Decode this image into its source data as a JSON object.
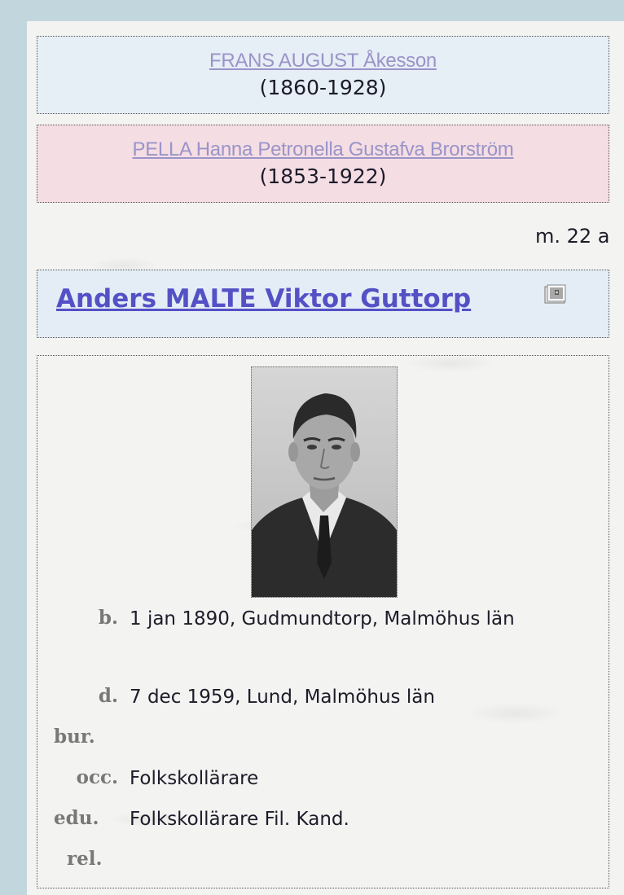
{
  "father": {
    "name": "FRANS AUGUST Åkesson",
    "years": "(1860-1928)"
  },
  "mother": {
    "name": "PELLA Hanna Petronella Gustafva Brorström",
    "years": "(1853-1922)"
  },
  "marriage": {
    "text": "m. 22 a"
  },
  "person": {
    "name": "Anders MALTE Viktor Guttorp",
    "album_icon": "photo-album-icon"
  },
  "facts": {
    "birth": {
      "label": "b.",
      "value": "1 jan 1890, Gudmundtorp, Malmöhus län"
    },
    "death": {
      "label": "d.",
      "value": "7 dec 1959, Lund, Malmöhus län"
    },
    "burial": {
      "label": "bur.",
      "value": ""
    },
    "occupation": {
      "label": "occ.",
      "value": "Folkskollärare"
    },
    "education": {
      "label": "edu.",
      "value": "Folkskollärare Fil. Kand."
    },
    "religion": {
      "label": "rel.",
      "value": ""
    }
  },
  "colors": {
    "father_box": "#e6eef6",
    "mother_box": "#f4dde3",
    "person_box": "#e4edf6",
    "link_visited": "#9a94c8",
    "link_primary": "#5451c6",
    "label_gray": "#787878"
  }
}
